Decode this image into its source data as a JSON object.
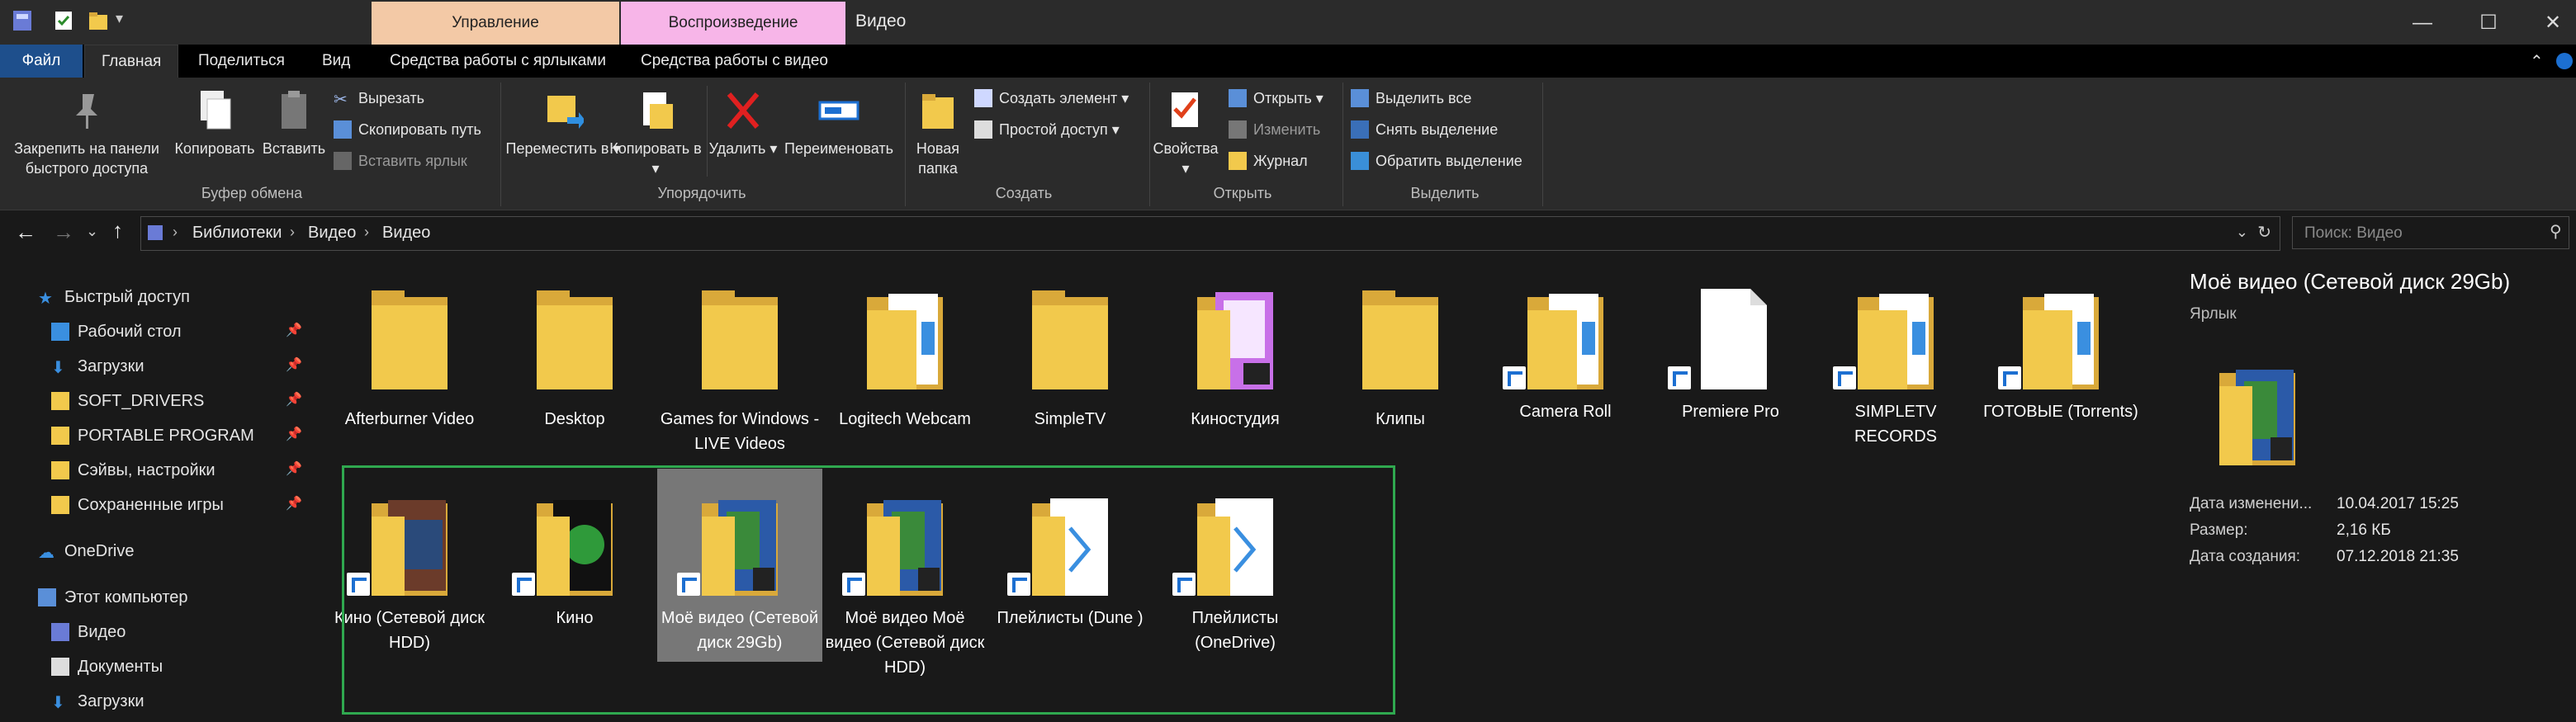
{
  "window": {
    "title": "Видео",
    "context_tabs": [
      {
        "label": "Управление",
        "color": "#f3c9a6"
      },
      {
        "label": "Воспроизведение",
        "color": "#f7b5e8"
      }
    ]
  },
  "ribbon_tabs": [
    {
      "label": "Файл"
    },
    {
      "label": "Главная"
    },
    {
      "label": "Поделиться"
    },
    {
      "label": "Вид"
    },
    {
      "label": "Средства работы с ярлыками"
    },
    {
      "label": "Средства работы с видео"
    }
  ],
  "ribbon": {
    "clipboard": {
      "group_label": "Буфер обмена",
      "pin_label": "Закрепить на панели быстрого доступа",
      "copy_label": "Копировать",
      "paste_label": "Вставить",
      "cut_label": "Вырезать",
      "copy_path_label": "Скопировать путь",
      "paste_shortcut_label": "Вставить ярлык"
    },
    "organize": {
      "group_label": "Упорядочить",
      "move_label": "Переместить в",
      "copyto_label": "Копировать в",
      "delete_label": "Удалить",
      "rename_label": "Переименовать"
    },
    "create": {
      "group_label": "Создать",
      "new_folder_label": "Новая папка",
      "new_item_label": "Создать элемент",
      "easy_access_label": "Простой доступ"
    },
    "open": {
      "group_label": "Открыть",
      "properties_label": "Свойства",
      "open_label": "Открыть",
      "edit_label": "Изменить",
      "history_label": "Журнал"
    },
    "select": {
      "group_label": "Выделить",
      "select_all_label": "Выделить все",
      "select_none_label": "Снять выделение",
      "invert_label": "Обратить выделение"
    }
  },
  "address": {
    "crumbs": [
      "Библиотеки",
      "Видео",
      "Видео"
    ],
    "search_placeholder": "Поиск: Видео"
  },
  "nav": {
    "quick_access": "Быстрый доступ",
    "items": [
      {
        "label": "Рабочий стол",
        "pinned": true
      },
      {
        "label": "Загрузки",
        "pinned": true
      },
      {
        "label": "SOFT_DRIVERS",
        "pinned": true
      },
      {
        "label": "PORTABLE PROGRAM",
        "pinned": true
      },
      {
        "label": "Сэйвы, настройки",
        "pinned": true
      },
      {
        "label": "Сохраненные игры",
        "pinned": true
      }
    ],
    "onedrive": "OneDrive",
    "this_pc": "Этот компьютер",
    "pc_items": [
      {
        "label": "Видео"
      },
      {
        "label": "Документы"
      },
      {
        "label": "Загрузки"
      }
    ]
  },
  "files_row1": [
    {
      "name": "Afterburner Video",
      "shortcut": false
    },
    {
      "name": "Desktop",
      "shortcut": false
    },
    {
      "name": "Games for Windows - LIVE Videos",
      "shortcut": false
    },
    {
      "name": "Logitech Webcam",
      "shortcut": false
    },
    {
      "name": "SimpleTV",
      "shortcut": false
    },
    {
      "name": "Киностудия",
      "shortcut": false
    },
    {
      "name": "Клипы",
      "shortcut": false
    },
    {
      "name": "Camera Roll",
      "shortcut": true
    },
    {
      "name": "Premiere Pro",
      "shortcut": true
    },
    {
      "name": "SIMPLETV RECORDS",
      "shortcut": true
    },
    {
      "name": "ГОТОВЫЕ (Torrents)",
      "shortcut": true
    }
  ],
  "files_row2": [
    {
      "name": "Кино (Сетевой диск HDD)",
      "shortcut": true
    },
    {
      "name": "Кино",
      "shortcut": true
    },
    {
      "name": "Моё видео (Сетевой диск 29Gb)",
      "shortcut": true,
      "selected": true
    },
    {
      "name": "Моё видео Моё видео (Сетевой диск HDD)",
      "shortcut": true
    },
    {
      "name": "Плейлисты (Dune )",
      "shortcut": true
    },
    {
      "name": "Плейлисты (OneDrive)",
      "shortcut": true
    }
  ],
  "details": {
    "title": "Моё видео (Сетевой диск 29Gb)",
    "type": "Ярлык",
    "modified_label": "Дата изменени...",
    "modified_value": "10.04.2017 15:25",
    "size_label": "Размер:",
    "size_value": "2,16 КБ",
    "created_label": "Дата создания:",
    "created_value": "07.12.2018 21:35"
  },
  "colors": {
    "folder": "#f2c94c",
    "folder_dark": "#d9a93a",
    "accent_blue": "#1e4f8c",
    "selection_box": "#2fa84f"
  }
}
